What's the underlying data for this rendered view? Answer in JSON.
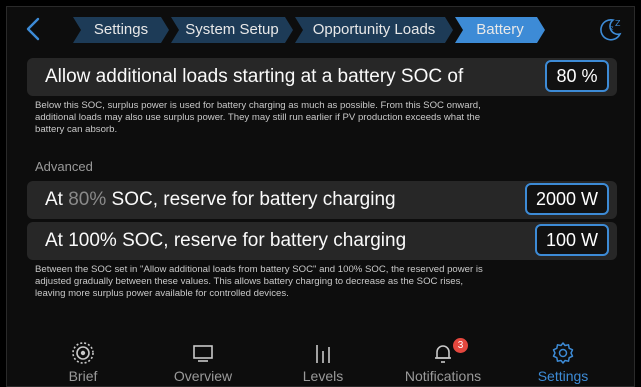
{
  "breadcrumb": [
    {
      "label": "Settings",
      "active": false
    },
    {
      "label": "System Setup",
      "active": false
    },
    {
      "label": "Opportunity Loads",
      "active": false
    },
    {
      "label": "Battery",
      "active": true
    }
  ],
  "icons": {
    "back": "chevron-left-icon",
    "top_right": "moon-zz-icon"
  },
  "soc_threshold": {
    "label": "Allow additional loads starting at a battery SOC of",
    "value": "80 %"
  },
  "soc_threshold_note": "Below this SOC, surplus power is used for battery charging as much as possible. From this SOC onward, additional loads may also use surplus power. They may still run earlier if PV production exceeds what the battery can absorb.",
  "advanced": {
    "title": "Advanced",
    "reserve_at_threshold": {
      "prefix": "At ",
      "soc": "80%",
      "suffix": " SOC, reserve for battery charging",
      "value": "2000 W"
    },
    "reserve_at_full": {
      "label": "At 100% SOC, reserve for battery charging",
      "value": "100 W"
    },
    "note": "Between the SOC set in \"Allow additional loads from battery SOC\" and 100% SOC, the reserved power is adjusted gradually between these values. This allows battery charging to decrease as the SOC rises, leaving more surplus power available for controlled devices."
  },
  "nav": {
    "items": [
      {
        "label": "Brief",
        "icon": "brief-ring-icon",
        "active": false
      },
      {
        "label": "Overview",
        "icon": "overview-icon",
        "active": false
      },
      {
        "label": "Levels",
        "icon": "levels-icon",
        "active": false
      },
      {
        "label": "Notifications",
        "icon": "bell-icon",
        "active": false,
        "badge": "3"
      },
      {
        "label": "Settings",
        "icon": "gear-icon",
        "active": true
      }
    ]
  },
  "colors": {
    "accent": "#3d8bd6",
    "crumb_bg": "#1d3b57",
    "row_bg": "#272727",
    "badge": "#e5473e"
  }
}
